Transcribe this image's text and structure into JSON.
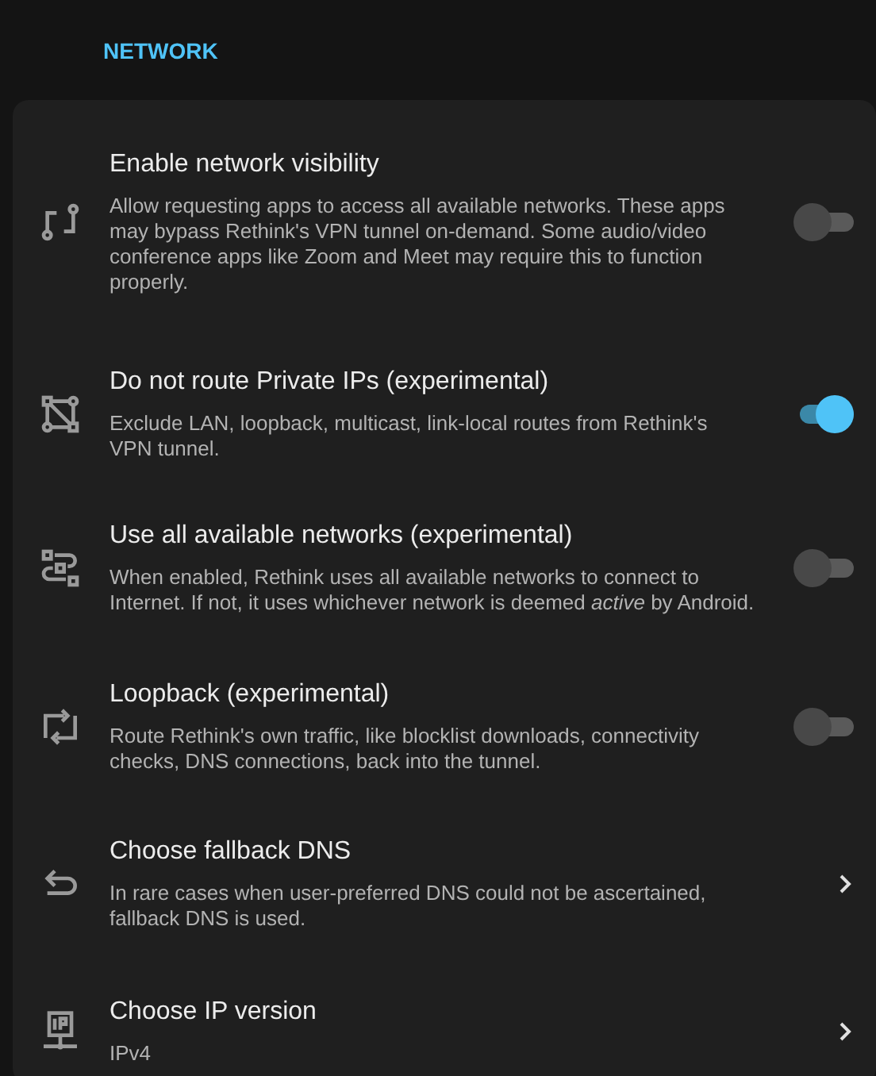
{
  "section_title": "NETWORK",
  "settings": [
    {
      "kind": "toggle",
      "title": "Enable network visibility",
      "description": "Allow requesting apps to access all available networks. These apps may bypass Rethink's VPN tunnel on-demand. Some audio/video conference apps like Zoom and Meet may require this to function properly.",
      "on": false
    },
    {
      "kind": "toggle",
      "title": "Do not route Private IPs (experimental)",
      "description": "Exclude LAN, loopback, multicast, link-local routes from Rethink's VPN tunnel.",
      "on": true
    },
    {
      "kind": "toggle",
      "title": "Use all available networks (experimental)",
      "description": "When enabled, Rethink uses all available networks to connect to Internet. If not, it uses whichever network is deemed *active* by Android.",
      "on": false
    },
    {
      "kind": "toggle",
      "title": "Loopback (experimental)",
      "description": "Route Rethink's own traffic, like blocklist downloads, connectivity checks, DNS connections, back into the tunnel.",
      "on": false
    },
    {
      "kind": "link",
      "title": "Choose fallback DNS",
      "description": "In rare cases when user-preferred DNS could not be ascertained, fallback DNS is used."
    },
    {
      "kind": "link",
      "title": "Choose IP version",
      "description": "IPv4"
    }
  ]
}
